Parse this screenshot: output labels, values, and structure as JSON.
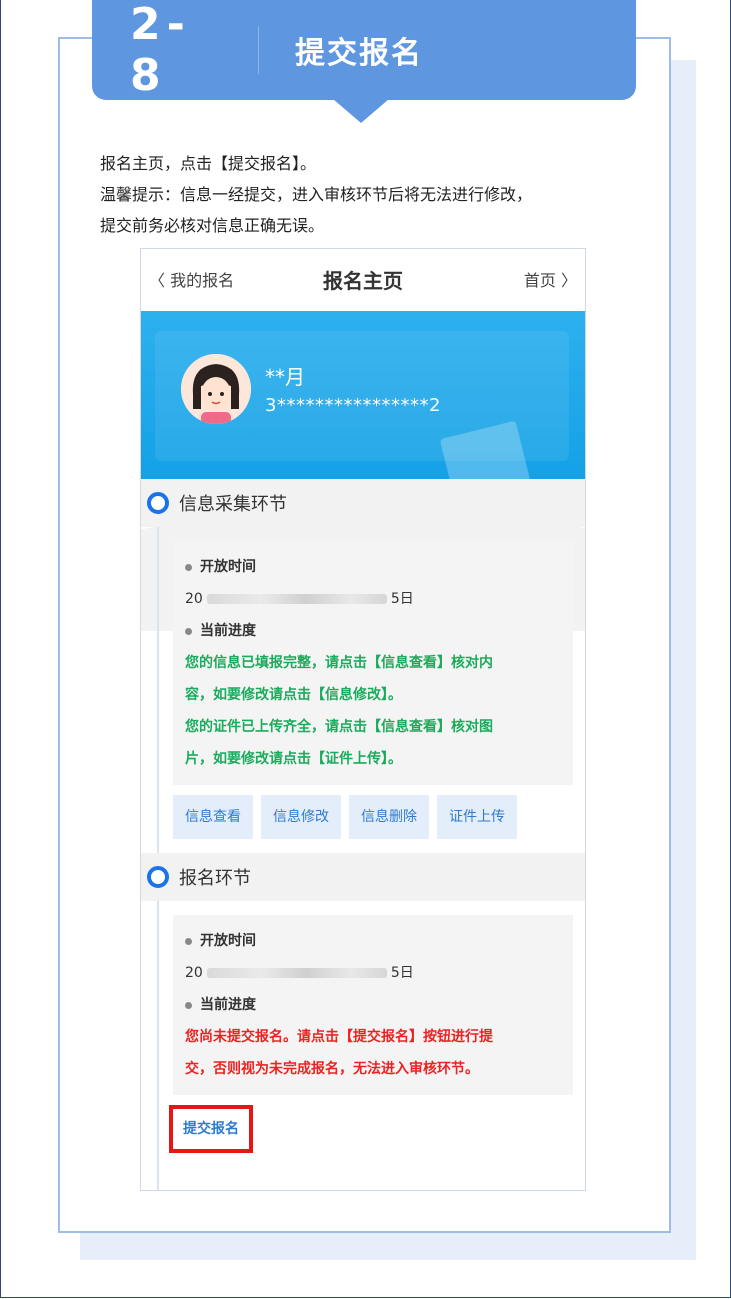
{
  "step": {
    "number": "2-8",
    "title": "提交报名"
  },
  "description": {
    "line1": "报名主页，点击【提交报名】。",
    "line2": "温馨提示：信息一经提交，进入审核环节后将无法进行修改，",
    "line3": "提交前务必核对信息正确无误。"
  },
  "phone": {
    "nav": {
      "back_label": "〈 我的报名",
      "title": "报名主页",
      "home_label": "首页 〉"
    },
    "user": {
      "name": "**月",
      "id": "3****************2"
    },
    "sections": [
      {
        "title": "信息采集环节",
        "open_time_label": "开放时间",
        "date_prefix": "20",
        "date_suffix": "5日",
        "progress_label": "当前进度",
        "progress_lines": [
          "您的信息已填报完整，请点击【信息查看】核对内",
          "容，如要修改请点击【信息修改】。",
          "您的证件已上传齐全，请点击【信息查看】核对图",
          "片，如要修改请点击【证件上传】。"
        ],
        "buttons": [
          "信息查看",
          "信息修改",
          "信息删除",
          "证件上传"
        ]
      },
      {
        "title": "报名环节",
        "open_time_label": "开放时间",
        "date_prefix": "20",
        "date_suffix": "5日",
        "progress_label": "当前进度",
        "progress_lines": [
          "您尚未提交报名。请点击【提交报名】按钮进行提",
          "交，否则视为未完成报名，无法进入审核环节。"
        ],
        "submit_label": "提交报名"
      }
    ]
  },
  "colors": {
    "accent": "#5e96e0",
    "banner": "#14a1e6",
    "green": "#1bab5c",
    "red": "#ee2222",
    "highlight": "#e51616"
  }
}
